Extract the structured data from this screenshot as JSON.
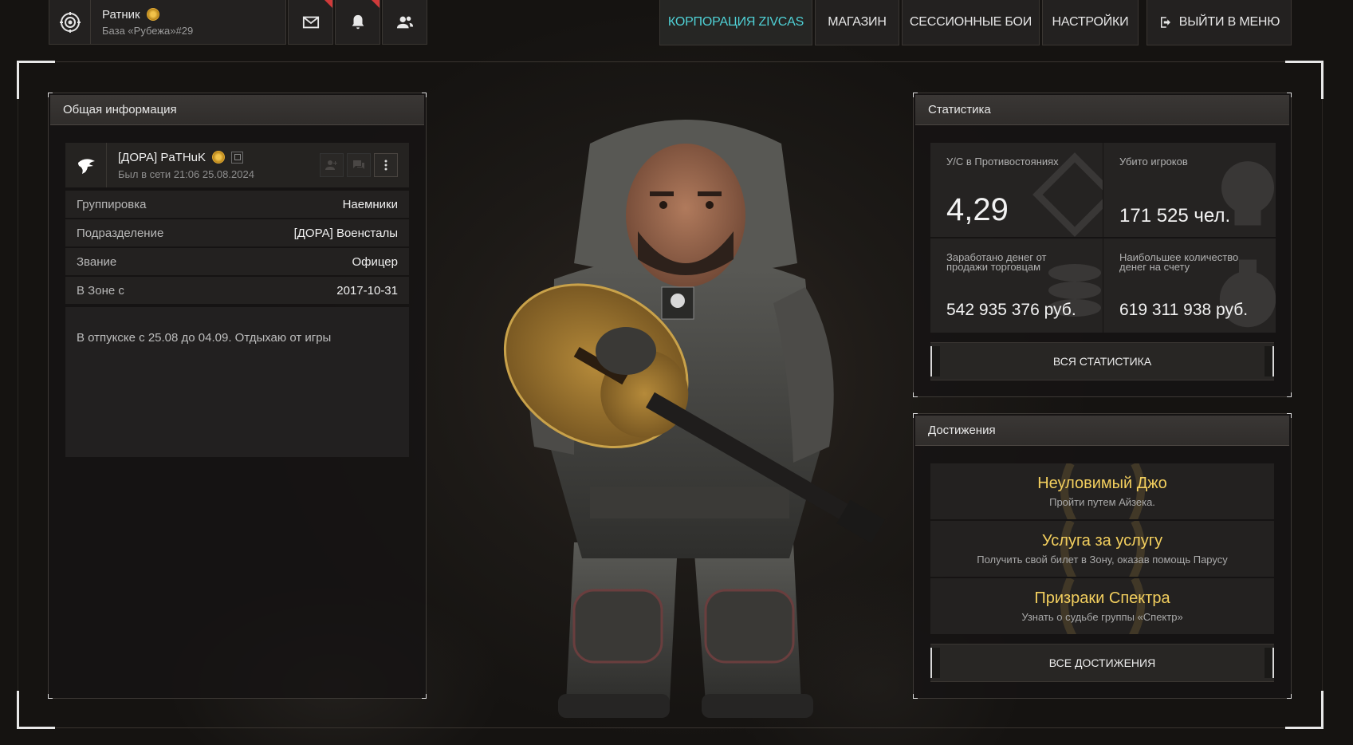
{
  "header": {
    "profile": {
      "rank": "Ратник",
      "base": "База «Рубежа»#29"
    },
    "icons": {
      "mail": "mail-icon",
      "notifications": "bell-icon",
      "friends": "friends-icon"
    },
    "nav": [
      {
        "label": "КОРПОРАЦИЯ ZIVCAS",
        "active": true
      },
      {
        "label": "МАГАЗИН",
        "active": false
      },
      {
        "label": "СЕССИОННЫЕ БОИ",
        "active": false
      },
      {
        "label": "НАСТРОЙКИ",
        "active": false
      }
    ],
    "exit_label": "ВЫЙТИ В МЕНЮ"
  },
  "general": {
    "title": "Общая информация",
    "player": {
      "name": "[ДОРА] PaTHuK",
      "last_seen": "Был в сети 21:06 25.08.2024"
    },
    "rows": [
      {
        "key": "Группировка",
        "value": "Наемники"
      },
      {
        "key": "Подразделение",
        "value": "[ДОРА] Военсталы"
      },
      {
        "key": "Звание",
        "value": "Офицер"
      },
      {
        "key": "В Зоне с",
        "value": "2017-10-31"
      }
    ],
    "note": "В отпукске с 25.08 до 04.09. Отдыхаю от игры"
  },
  "stats": {
    "title": "Статистика",
    "cells": [
      {
        "label": "У/С в Противостояниях",
        "value": "4,29"
      },
      {
        "label": "Убито игроков",
        "value": "171 525 чел."
      },
      {
        "label": "Заработано денег от продажи торговцам",
        "value": "542 935 376 руб."
      },
      {
        "label": "Наибольшее количество денег на счету",
        "value": "619 311 938 руб."
      }
    ],
    "all_label": "ВСЯ СТАТИСТИКА"
  },
  "achievements": {
    "title": "Достижения",
    "items": [
      {
        "title": "Неуловимый Джо",
        "desc": "Пройти путем Айзека."
      },
      {
        "title": "Услуга за услугу",
        "desc": "Получить свой билет в Зону, оказав помощь Парусу"
      },
      {
        "title": "Призраки Спектра",
        "desc": "Узнать о судьбе группы «Спектр»"
      }
    ],
    "all_label": "ВСЕ ДОСТИЖЕНИЯ"
  },
  "colors": {
    "accent": "#4fd1d6",
    "achievement_gold": "#f3cf5e",
    "alert_red": "#d03a3a"
  }
}
